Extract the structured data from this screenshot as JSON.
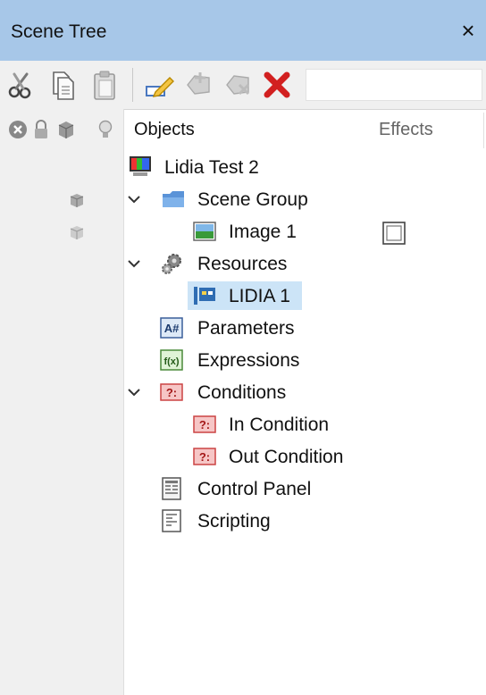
{
  "window": {
    "title": "Scene Tree",
    "close_glyph": "×"
  },
  "toolbar": {
    "icons": [
      "scissors-icon",
      "copy-icon",
      "paste-icon",
      "rename-icon",
      "add-icon",
      "remove-icon",
      "delete-icon"
    ],
    "search_value": ""
  },
  "columns": {
    "header_icons": [
      "visibility-icon",
      "lock-icon",
      "cube-icon",
      "light-icon"
    ],
    "objects": "Objects",
    "effects": "Effects"
  },
  "tree": [
    {
      "label": "Lidia Test 2",
      "icon": "scene-monitor-icon",
      "depth": 0
    },
    {
      "label": "Scene Group",
      "icon": "folder-icon",
      "depth": 1,
      "expanded": true
    },
    {
      "label": "Image 1",
      "icon": "image-icon",
      "depth": 2
    },
    {
      "label": "Resources",
      "icon": "gears-icon",
      "depth": 1,
      "expanded": true
    },
    {
      "label": "LIDIA 1",
      "icon": "resource-icon",
      "depth": 2,
      "selected": true
    },
    {
      "label": "Parameters",
      "icon": "parameters-icon",
      "depth": 1,
      "badge": "A#"
    },
    {
      "label": "Expressions",
      "icon": "expressions-icon",
      "depth": 1,
      "badge": "f(x)"
    },
    {
      "label": "Conditions",
      "icon": "conditions-icon",
      "depth": 1,
      "expanded": true,
      "badge": "?:"
    },
    {
      "label": "In Condition",
      "icon": "condition-icon",
      "depth": 2,
      "badge": "?:"
    },
    {
      "label": "Out Condition",
      "icon": "condition-icon",
      "depth": 2,
      "badge": "?:"
    },
    {
      "label": "Control Panel",
      "icon": "control-panel-icon",
      "depth": 1
    },
    {
      "label": "Scripting",
      "icon": "scripting-icon",
      "depth": 1
    }
  ],
  "colors": {
    "titlebar": "#a7c7e8",
    "selection": "#cce4f7",
    "panel": "#f0f0f0"
  }
}
